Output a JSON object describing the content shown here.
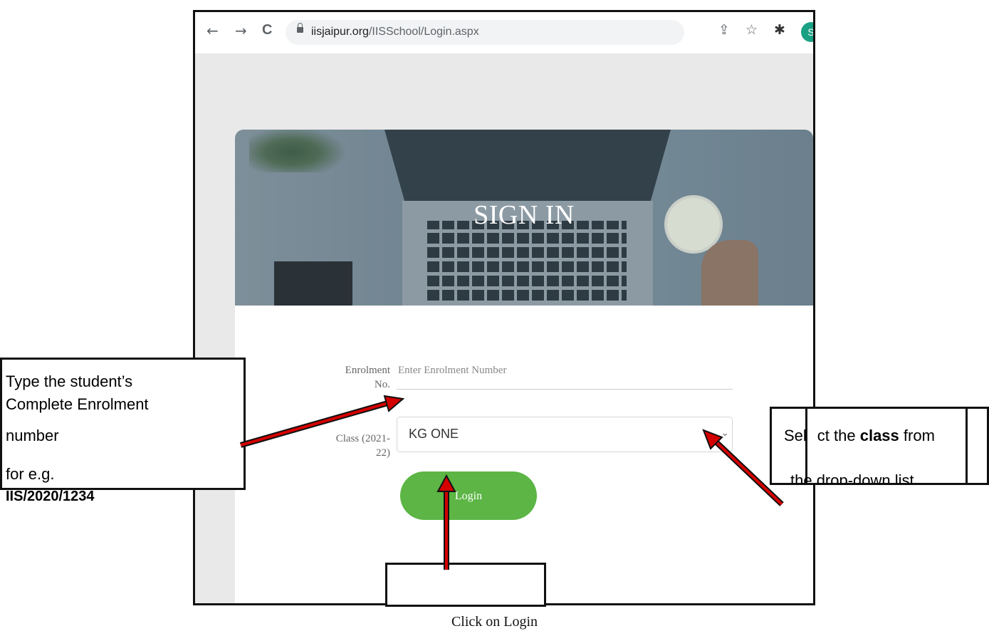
{
  "browser": {
    "url_host": "iisjaipur.org",
    "url_path": "/IISSchool/Login.aspx",
    "back_glyph": "←",
    "forward_glyph": "→",
    "reload_glyph": "C",
    "share_glyph": "⇪",
    "star_glyph": "☆",
    "extension_glyph": "✱",
    "profile_initial": "S"
  },
  "page": {
    "hero_title": "SIGN IN",
    "enrolment_label_line1": "Enrolment",
    "enrolment_label_line2": "No.",
    "enrolment_placeholder": "Enter Enrolment Number",
    "class_label_line1": "Class (2021-",
    "class_label_line2": "22)",
    "class_selected": "KG ONE",
    "class_arrow": "⌄",
    "login_label": "Login"
  },
  "annotations": {
    "enrolment_line1": "Type the student’s",
    "enrolment_line2": "Complete Enrolment",
    "enrolment_line3": "number",
    "enrolment_line4": "for e.g.",
    "enrolment_example": "IIS/2020/1234",
    "class_part1": "Sel",
    "class_part2": "ct the ",
    "class_bold": "class",
    "class_part3": " from",
    "class_line2": "the drop-down list",
    "login_caption": "Click on Login"
  },
  "colors": {
    "login_green": "#5cb544",
    "arrow_red": "#d40000",
    "profile_teal": "#1aa184"
  }
}
